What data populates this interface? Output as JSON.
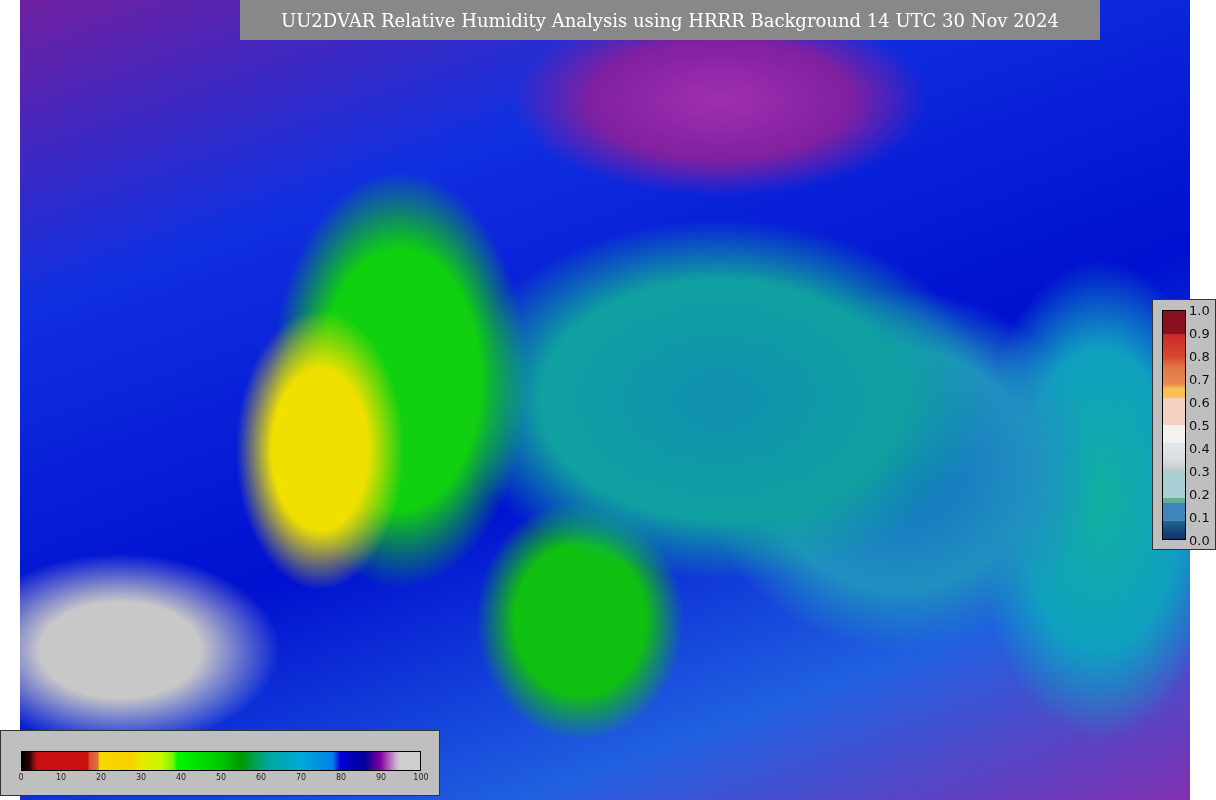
{
  "title": "UU2DVAR Relative Humidity Analysis using HRRR Background 14 UTC 30 Nov 2024",
  "humidity_colorbar": {
    "ticks": [
      "0",
      "10",
      "20",
      "30",
      "40",
      "50",
      "60",
      "70",
      "80",
      "90",
      "100"
    ]
  },
  "observation_colorbar": {
    "ticks": [
      "1.0",
      "0.9",
      "0.8",
      "0.7",
      "0.6",
      "0.5",
      "0.4",
      "0.3",
      "0.2",
      "0.1",
      "0.0"
    ]
  }
}
